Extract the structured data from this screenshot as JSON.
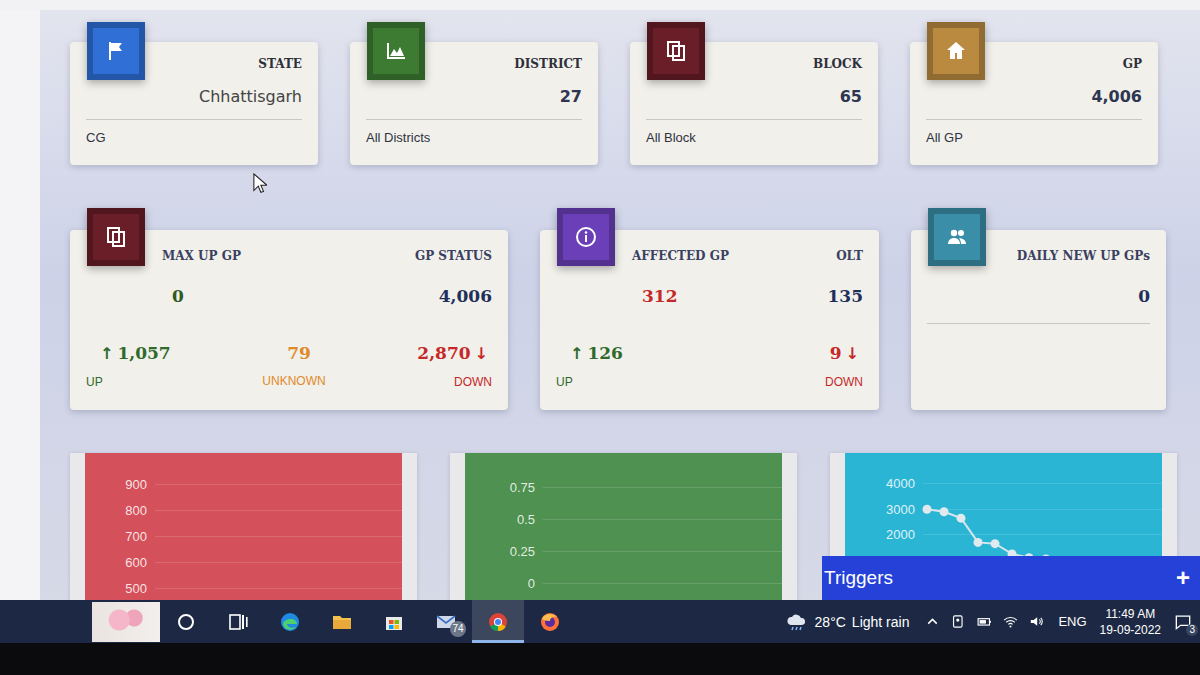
{
  "summary_cards": [
    {
      "title": "STATE",
      "value": "Chhattisgarh",
      "footer": "CG",
      "color": "#2f6fd6"
    },
    {
      "title": "DISTRICT",
      "value": "27",
      "footer": "All Districts",
      "color": "#3d7b33"
    },
    {
      "title": "BLOCK",
      "value": "65",
      "footer": "All Block",
      "color": "#6a1e27"
    },
    {
      "title": "GP",
      "value": "4,006",
      "footer": "All GP",
      "color": "#b98a40"
    }
  ],
  "status_cards": [
    {
      "color": "#6a1e27",
      "left": {
        "label": "MAX UP GP",
        "value": "0",
        "color": "#2f5a22"
      },
      "right": {
        "label": "GP STATUS",
        "value": "4,006",
        "color": "#1f2f5a"
      },
      "stats": [
        {
          "kind": "up",
          "arrow": "↑",
          "value": "1,057",
          "label": "UP",
          "color": "#2f6a2a"
        },
        {
          "kind": "unknown",
          "value": "79",
          "label": "UNKNOWN",
          "color": "#e08a2a"
        },
        {
          "kind": "down",
          "arrow": "↓",
          "value": "2,870",
          "label": "DOWN",
          "color": "#c62828"
        }
      ]
    },
    {
      "color": "#6a3fb8",
      "left": {
        "label": "AFFECTED GP",
        "value": "312",
        "color": "#c62828"
      },
      "right": {
        "label": "OLT",
        "value": "135",
        "color": "#1f2f5a"
      },
      "stats": [
        {
          "kind": "up",
          "arrow": "↑",
          "value": "126",
          "label": "UP",
          "color": "#2f6a2a"
        },
        {
          "kind": "down",
          "arrow": "↓",
          "value": "9",
          "label": "DOWN",
          "color": "#c62828"
        }
      ]
    },
    {
      "color": "#3b8ea8",
      "right": {
        "label": "DAILY NEW UP GPs",
        "value": "0",
        "color": "#1f2f5a"
      },
      "stats": []
    }
  ],
  "charts": [
    {
      "color": "#d4505a",
      "ticks": [
        "900",
        "800",
        "700",
        "600",
        "500"
      ],
      "series": []
    },
    {
      "color": "#4e9150",
      "ticks": [
        "0.75",
        "0.5",
        "0.25",
        "0"
      ],
      "series": []
    },
    {
      "color": "#2bb5d4",
      "ticks": [
        "4000",
        "3000",
        "2000"
      ],
      "series": [
        3000,
        2900,
        2650,
        1700,
        1650,
        1250,
        1100,
        1050
      ]
    }
  ],
  "triggers": {
    "title": "Triggers",
    "action": "+"
  },
  "taskbar": {
    "buttons": [
      {
        "selected": false,
        "badge": ""
      },
      {
        "selected": false,
        "badge": ""
      },
      {
        "selected": false,
        "badge": ""
      },
      {
        "selected": false,
        "badge": ""
      },
      {
        "selected": false,
        "badge": ""
      },
      {
        "selected": false,
        "badge": "74"
      },
      {
        "selected": true,
        "badge": ""
      },
      {
        "selected": false,
        "badge": ""
      }
    ],
    "weather": {
      "temp": "28°C",
      "condition": "Light rain"
    },
    "language": "ENG",
    "time": "11:49 AM",
    "date": "19-09-2022",
    "notifications": "3"
  }
}
